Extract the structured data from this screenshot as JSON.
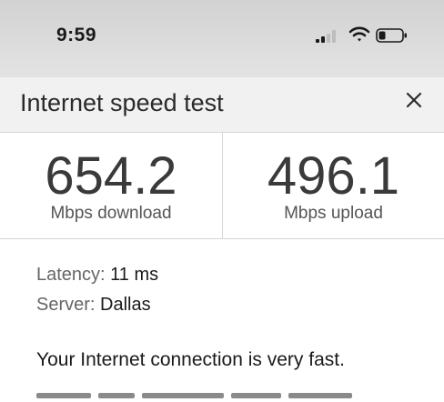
{
  "status_bar": {
    "time": "9:59",
    "icons": [
      "cellular-signal-icon",
      "wifi-icon",
      "battery-icon"
    ]
  },
  "dialog": {
    "title": "Internet speed test",
    "close_icon": "close-icon"
  },
  "results": {
    "download": {
      "value": "654.2",
      "label": "Mbps download"
    },
    "upload": {
      "value": "496.1",
      "label": "Mbps upload"
    },
    "latency": {
      "key": "Latency:",
      "value": "11 ms"
    },
    "server": {
      "key": "Server:",
      "value": "Dallas"
    },
    "summary": "Your Internet connection is very fast."
  },
  "colors": {
    "header_bg": "#f1f1f1",
    "divider": "#d6d6d6",
    "text_primary": "#2a2a2a",
    "text_secondary": "#555555"
  }
}
